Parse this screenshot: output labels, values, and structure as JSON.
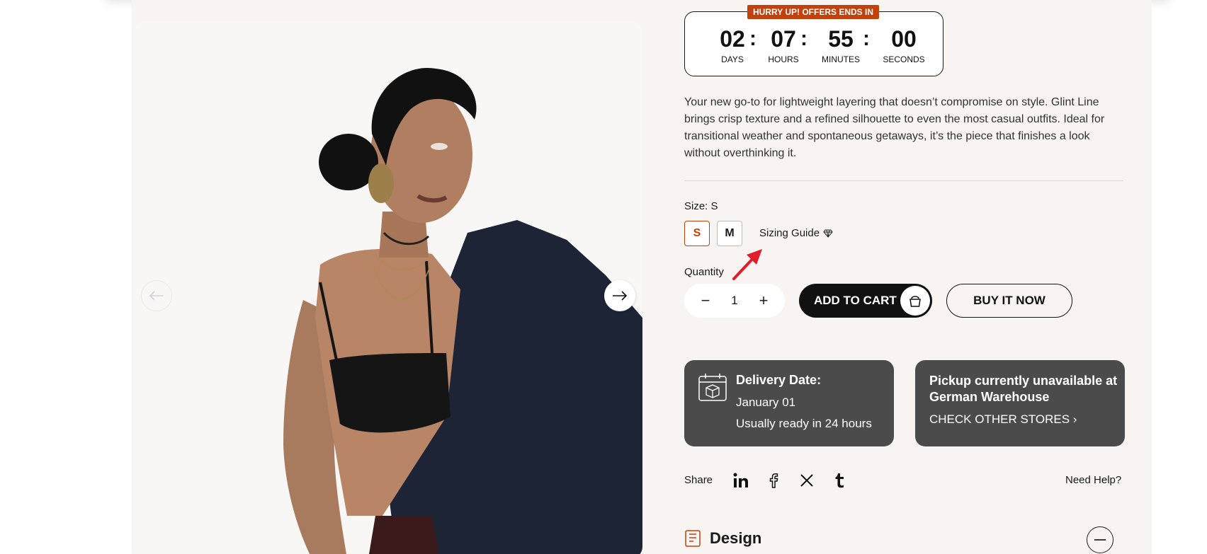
{
  "countdown": {
    "badge": "HURRY UP! OFFERS ENDS IN",
    "units": [
      {
        "value": "02",
        "label": "DAYS"
      },
      {
        "value": "07",
        "label": "HOURS"
      },
      {
        "value": "55",
        "label": "MINUTES"
      },
      {
        "value": "00",
        "label": "SECONDS"
      }
    ],
    "separator": ":"
  },
  "description": "Your new go-to for lightweight layering that doesn’t compromise on style. Glint Line brings crisp texture and a refined silhouette to even the most casual outfits. Ideal for transitional weather and spontaneous getaways, it’s the piece that finishes a look without overthinking it.",
  "size": {
    "label": "Size: S",
    "options": [
      "S",
      "M"
    ],
    "selected": "S",
    "guide_label": "Sizing Guide"
  },
  "quantity": {
    "label": "Quantity",
    "value": "1",
    "minus": "−",
    "plus": "+"
  },
  "buttons": {
    "add_to_cart": "ADD TO CART",
    "buy_now": "BUY IT NOW"
  },
  "delivery": {
    "title": "Delivery Date:",
    "date": "January 01",
    "ready": "Usually ready in 24 hours"
  },
  "pickup": {
    "title": "Pickup currently unavailable at German Warehouse",
    "link": "CHECK OTHER STORES ›"
  },
  "share": {
    "label": "Share",
    "networks": [
      "linkedin-icon",
      "facebook-icon",
      "x-icon",
      "tumblr-icon"
    ]
  },
  "help": "Need Help?",
  "accordion": {
    "design_title": "Design"
  },
  "colors": {
    "accent": "#c2410c",
    "card": "#4b4b4b",
    "arrow": "#e11d2a"
  }
}
